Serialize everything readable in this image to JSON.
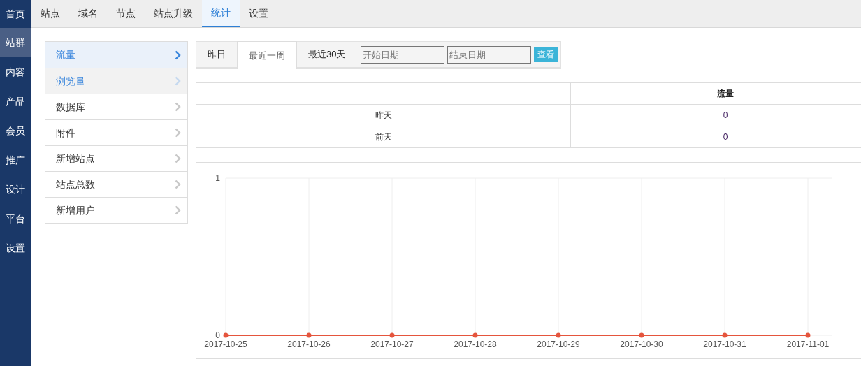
{
  "left_nav": [
    {
      "label": "首页",
      "selected": false
    },
    {
      "label": "站群",
      "selected": true
    },
    {
      "label": "内容",
      "selected": false
    },
    {
      "label": "产品",
      "selected": false
    },
    {
      "label": "会员",
      "selected": false
    },
    {
      "label": "推广",
      "selected": false
    },
    {
      "label": "设计",
      "selected": false
    },
    {
      "label": "平台",
      "selected": false
    },
    {
      "label": "设置",
      "selected": false
    }
  ],
  "top_tabs": [
    {
      "label": "站点",
      "selected": false
    },
    {
      "label": "域名",
      "selected": false
    },
    {
      "label": "节点",
      "selected": false
    },
    {
      "label": "站点升级",
      "selected": false
    },
    {
      "label": "统计",
      "selected": true
    },
    {
      "label": "设置",
      "selected": false
    }
  ],
  "side_menu": [
    {
      "label": "流量",
      "selected": true,
      "hovered": false
    },
    {
      "label": "浏览量",
      "selected": false,
      "hovered": true
    },
    {
      "label": "数据库",
      "selected": false,
      "hovered": false
    },
    {
      "label": "附件",
      "selected": false,
      "hovered": false
    },
    {
      "label": "新增站点",
      "selected": false,
      "hovered": false
    },
    {
      "label": "站点总数",
      "selected": false,
      "hovered": false
    },
    {
      "label": "新增用户",
      "selected": false,
      "hovered": false
    }
  ],
  "range_tabs": [
    {
      "label": "昨日",
      "selected": false
    },
    {
      "label": "最近一周",
      "selected": true
    },
    {
      "label": "最近30天",
      "selected": false
    }
  ],
  "start_date": {
    "placeholder": "开始日期"
  },
  "end_date": {
    "placeholder": "结束日期"
  },
  "view_button": "查看",
  "table": {
    "columns": [
      "流量"
    ],
    "rows": [
      {
        "label": "昨天",
        "value": "0"
      },
      {
        "label": "前天",
        "value": "0"
      }
    ]
  },
  "chart_data": {
    "type": "line",
    "categories": [
      "2017-10-25",
      "2017-10-26",
      "2017-10-27",
      "2017-10-28",
      "2017-10-29",
      "2017-10-30",
      "2017-10-31",
      "2017-11-01"
    ],
    "series": [
      {
        "color": "#e5553d",
        "marker": true,
        "values": [
          0,
          0,
          0,
          0,
          0,
          0,
          0,
          0
        ]
      }
    ],
    "grid": true,
    "ylim": [
      0,
      1
    ],
    "yticks": [
      0,
      1
    ]
  }
}
